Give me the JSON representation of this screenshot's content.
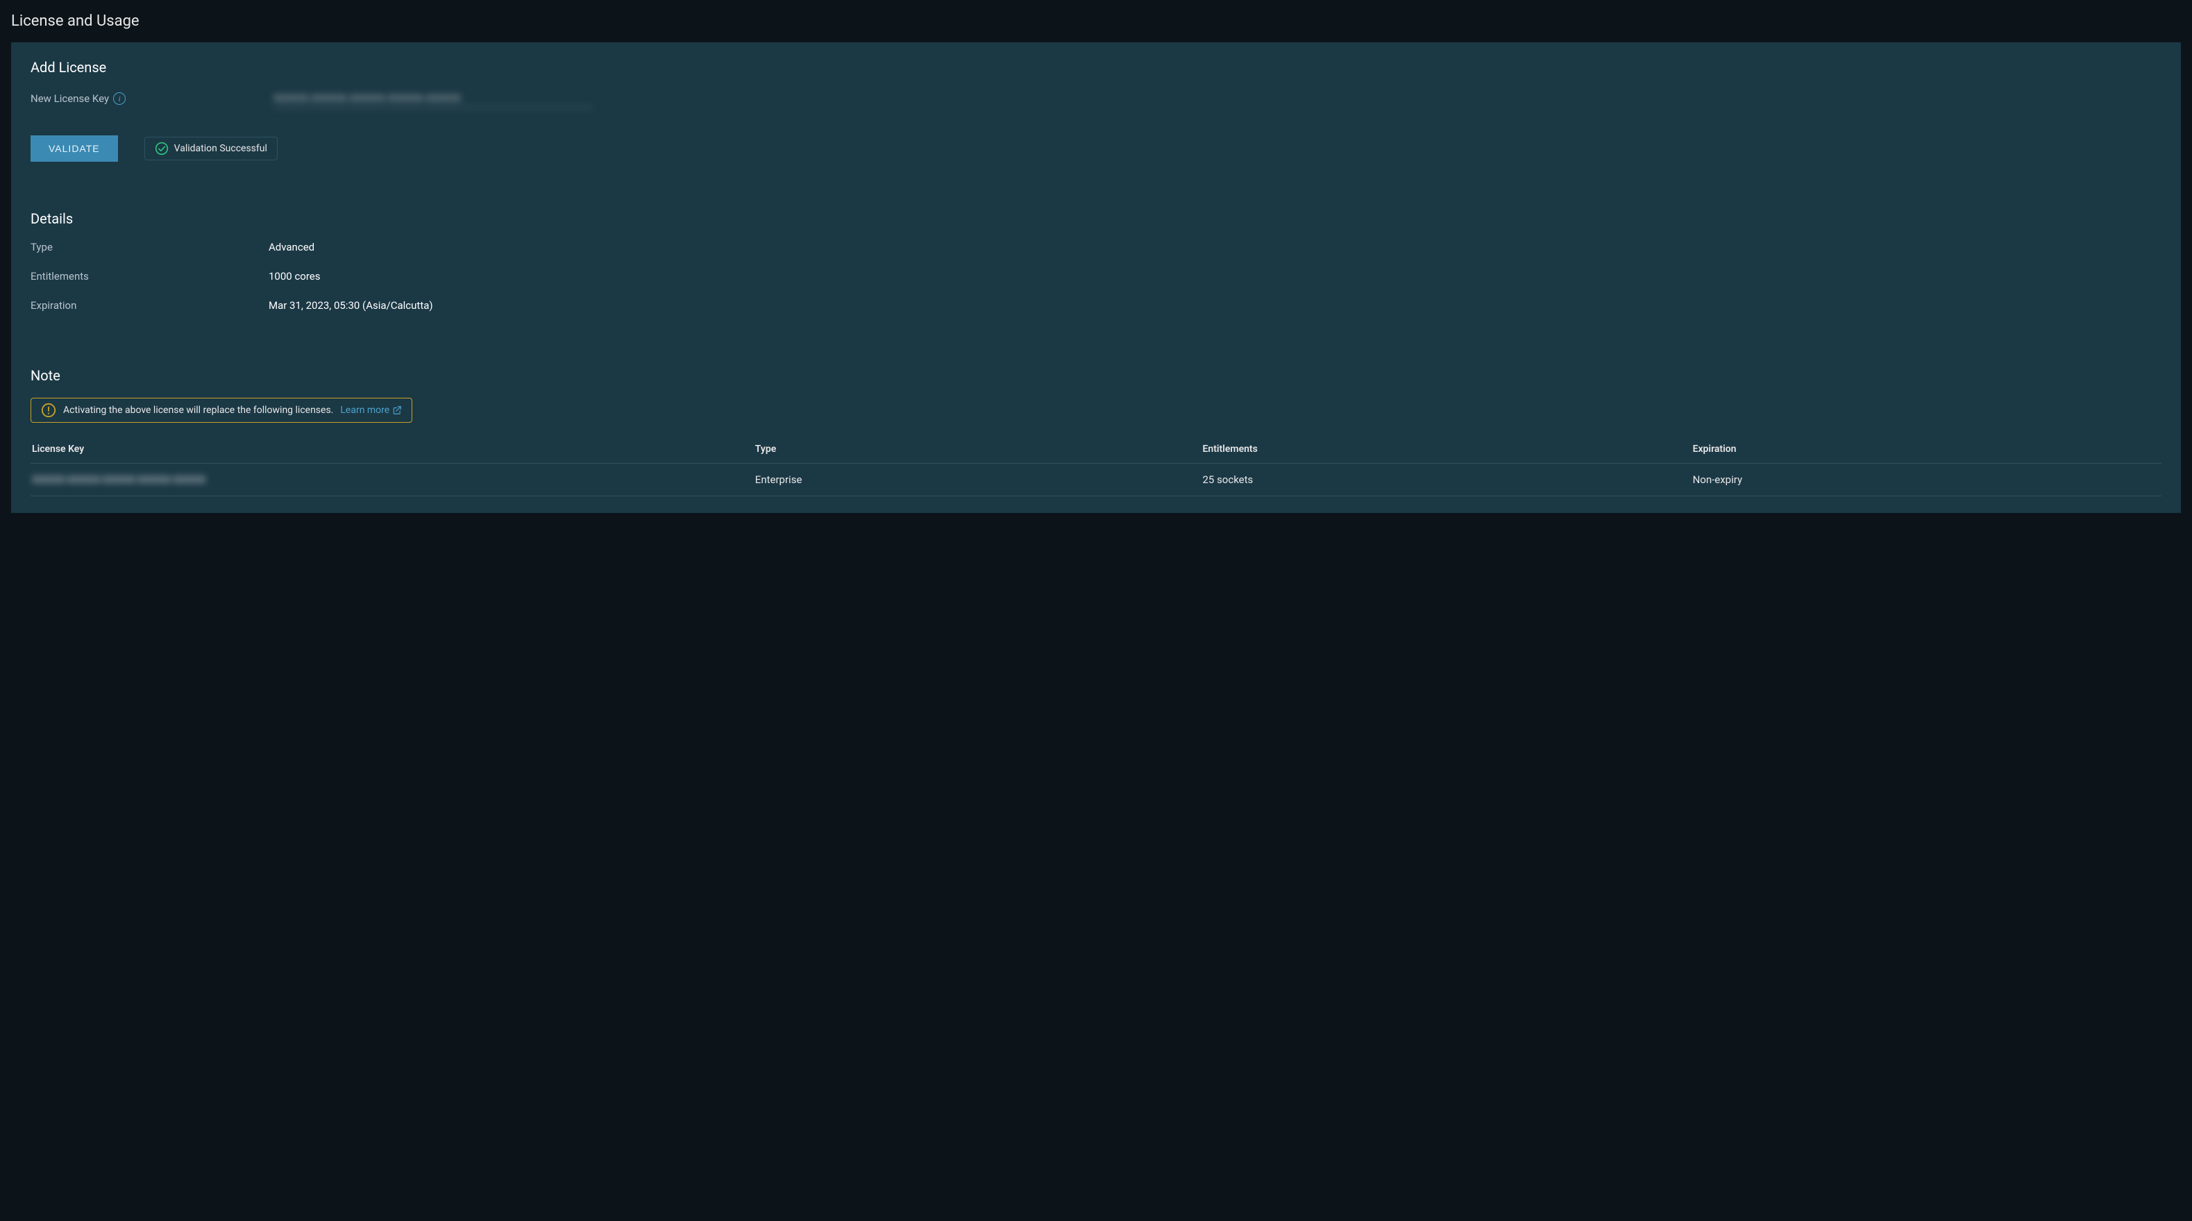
{
  "page": {
    "title": "License and Usage"
  },
  "addLicense": {
    "heading": "Add License",
    "newKeyLabel": "New License Key",
    "keyValue": "XXXXX-XXXXX-XXXXX-XXXXX-XXXXX",
    "validateLabel": "VALIDATE",
    "validationStatus": "Validation Successful"
  },
  "details": {
    "heading": "Details",
    "typeLabel": "Type",
    "typeValue": "Advanced",
    "entitlementsLabel": "Entitlements",
    "entitlementsValue": "1000 cores",
    "expirationLabel": "Expiration",
    "expirationValue": "Mar 31, 2023, 05:30 (Asia/Calcutta)"
  },
  "note": {
    "heading": "Note",
    "message": "Activating the above license will replace the following licenses.",
    "learnMore": "Learn more"
  },
  "table": {
    "headers": {
      "key": "License Key",
      "type": "Type",
      "entitlements": "Entitlements",
      "expiration": "Expiration"
    },
    "rows": [
      {
        "key": "XXXXX-XXXXX-XXXXX-XXXXX-XXXXX",
        "type": "Enterprise",
        "entitlements": "25 sockets",
        "expiration": "Non-expiry"
      }
    ]
  }
}
